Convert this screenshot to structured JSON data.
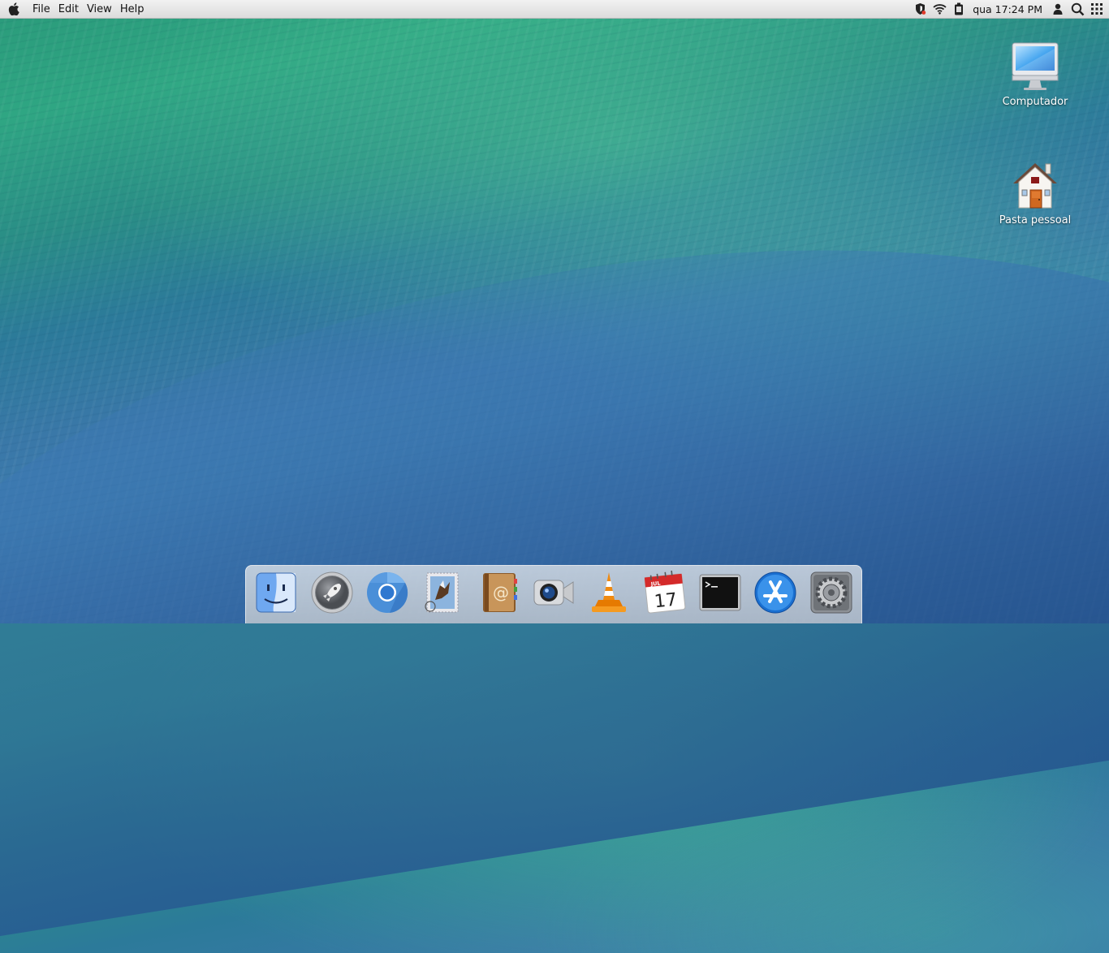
{
  "menubar": {
    "apple_icon": "apple-icon",
    "menus": [
      "File",
      "Edit",
      "View",
      "Help"
    ],
    "clock": "qua 17:24 PM",
    "tray": [
      "shield-icon",
      "wifi-icon",
      "battery-icon",
      "user-icon",
      "search-icon",
      "grid-icon"
    ]
  },
  "desktop": {
    "icons": [
      {
        "label": "Computador",
        "icon": "computer-icon"
      },
      {
        "label": "Pasta pessoal",
        "icon": "home-folder-icon"
      }
    ]
  },
  "dock": {
    "apps": [
      "finder",
      "launchpad",
      "chromium",
      "mail",
      "contacts",
      "facetime",
      "vlc",
      "calendar",
      "terminal",
      "app-store",
      "system-preferences"
    ],
    "calendar": {
      "month": "JUL",
      "day": "17"
    }
  },
  "colors": {
    "menubar_bg": "#e6e6e6",
    "wallpaper_green": "#2fa683",
    "wallpaper_blue": "#3a6ea6"
  }
}
